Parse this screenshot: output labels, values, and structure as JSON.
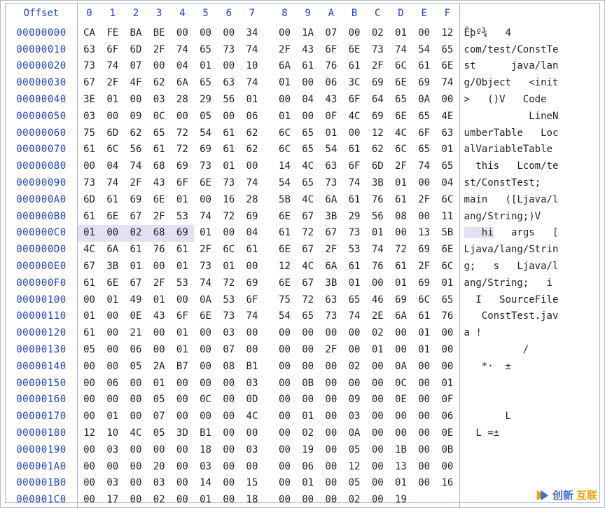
{
  "header": {
    "offset": "Offset",
    "cols": [
      "0",
      "1",
      "2",
      "3",
      "4",
      "5",
      "6",
      "7",
      "8",
      "9",
      "A",
      "B",
      "C",
      "D",
      "E",
      "F"
    ]
  },
  "logo": {
    "part1": "创新",
    "part2": "互联"
  },
  "selection": {
    "row": 12,
    "cols": [
      0,
      1,
      2,
      3,
      4
    ]
  },
  "rows": [
    {
      "offset": "00000000",
      "hex": [
        "CA",
        "FE",
        "BA",
        "BE",
        "00",
        "00",
        "00",
        "34",
        "00",
        "1A",
        "07",
        "00",
        "02",
        "01",
        "00",
        "12"
      ],
      "ascii": "Êþº¾   4        "
    },
    {
      "offset": "00000010",
      "hex": [
        "63",
        "6F",
        "6D",
        "2F",
        "74",
        "65",
        "73",
        "74",
        "2F",
        "43",
        "6F",
        "6E",
        "73",
        "74",
        "54",
        "65"
      ],
      "ascii": "com/test/ConstTe"
    },
    {
      "offset": "00000020",
      "hex": [
        "73",
        "74",
        "07",
        "00",
        "04",
        "01",
        "00",
        "10",
        "6A",
        "61",
        "76",
        "61",
        "2F",
        "6C",
        "61",
        "6E"
      ],
      "ascii": "st      java/lan"
    },
    {
      "offset": "00000030",
      "hex": [
        "67",
        "2F",
        "4F",
        "62",
        "6A",
        "65",
        "63",
        "74",
        "01",
        "00",
        "06",
        "3C",
        "69",
        "6E",
        "69",
        "74"
      ],
      "ascii": "g/Object   <init"
    },
    {
      "offset": "00000040",
      "hex": [
        "3E",
        "01",
        "00",
        "03",
        "28",
        "29",
        "56",
        "01",
        "00",
        "04",
        "43",
        "6F",
        "64",
        "65",
        "0A",
        "00"
      ],
      "ascii": ">   ()V   Code  "
    },
    {
      "offset": "00000050",
      "hex": [
        "03",
        "00",
        "09",
        "0C",
        "00",
        "05",
        "00",
        "06",
        "01",
        "00",
        "0F",
        "4C",
        "69",
        "6E",
        "65",
        "4E"
      ],
      "ascii": "           LineN"
    },
    {
      "offset": "00000060",
      "hex": [
        "75",
        "6D",
        "62",
        "65",
        "72",
        "54",
        "61",
        "62",
        "6C",
        "65",
        "01",
        "00",
        "12",
        "4C",
        "6F",
        "63"
      ],
      "ascii": "umberTable   Loc"
    },
    {
      "offset": "00000070",
      "hex": [
        "61",
        "6C",
        "56",
        "61",
        "72",
        "69",
        "61",
        "62",
        "6C",
        "65",
        "54",
        "61",
        "62",
        "6C",
        "65",
        "01"
      ],
      "ascii": "alVariableTable "
    },
    {
      "offset": "00000080",
      "hex": [
        "00",
        "04",
        "74",
        "68",
        "69",
        "73",
        "01",
        "00",
        "14",
        "4C",
        "63",
        "6F",
        "6D",
        "2F",
        "74",
        "65"
      ],
      "ascii": "  this   Lcom/te"
    },
    {
      "offset": "00000090",
      "hex": [
        "73",
        "74",
        "2F",
        "43",
        "6F",
        "6E",
        "73",
        "74",
        "54",
        "65",
        "73",
        "74",
        "3B",
        "01",
        "00",
        "04"
      ],
      "ascii": "st/ConstTest;   "
    },
    {
      "offset": "000000A0",
      "hex": [
        "6D",
        "61",
        "69",
        "6E",
        "01",
        "00",
        "16",
        "28",
        "5B",
        "4C",
        "6A",
        "61",
        "76",
        "61",
        "2F",
        "6C"
      ],
      "ascii": "main   ([Ljava/l"
    },
    {
      "offset": "000000B0",
      "hex": [
        "61",
        "6E",
        "67",
        "2F",
        "53",
        "74",
        "72",
        "69",
        "6E",
        "67",
        "3B",
        "29",
        "56",
        "08",
        "00",
        "11"
      ],
      "ascii": "ang/String;)V   "
    },
    {
      "offset": "000000C0",
      "hex": [
        "01",
        "00",
        "02",
        "68",
        "69",
        "01",
        "00",
        "04",
        "61",
        "72",
        "67",
        "73",
        "01",
        "00",
        "13",
        "5B"
      ],
      "ascii": "   hi   args   ["
    },
    {
      "offset": "000000D0",
      "hex": [
        "4C",
        "6A",
        "61",
        "76",
        "61",
        "2F",
        "6C",
        "61",
        "6E",
        "67",
        "2F",
        "53",
        "74",
        "72",
        "69",
        "6E"
      ],
      "ascii": "Ljava/lang/Strin"
    },
    {
      "offset": "000000E0",
      "hex": [
        "67",
        "3B",
        "01",
        "00",
        "01",
        "73",
        "01",
        "00",
        "12",
        "4C",
        "6A",
        "61",
        "76",
        "61",
        "2F",
        "6C"
      ],
      "ascii": "g;   s   Ljava/l"
    },
    {
      "offset": "000000F0",
      "hex": [
        "61",
        "6E",
        "67",
        "2F",
        "53",
        "74",
        "72",
        "69",
        "6E",
        "67",
        "3B",
        "01",
        "00",
        "01",
        "69",
        "01"
      ],
      "ascii": "ang/String;   i "
    },
    {
      "offset": "00000100",
      "hex": [
        "00",
        "01",
        "49",
        "01",
        "00",
        "0A",
        "53",
        "6F",
        "75",
        "72",
        "63",
        "65",
        "46",
        "69",
        "6C",
        "65"
      ],
      "ascii": "  I   SourceFile"
    },
    {
      "offset": "00000110",
      "hex": [
        "01",
        "00",
        "0E",
        "43",
        "6F",
        "6E",
        "73",
        "74",
        "54",
        "65",
        "73",
        "74",
        "2E",
        "6A",
        "61",
        "76"
      ],
      "ascii": "   ConstTest.jav"
    },
    {
      "offset": "00000120",
      "hex": [
        "61",
        "00",
        "21",
        "00",
        "01",
        "00",
        "03",
        "00",
        "00",
        "00",
        "00",
        "00",
        "02",
        "00",
        "01",
        "00"
      ],
      "ascii": "a !             "
    },
    {
      "offset": "00000130",
      "hex": [
        "05",
        "00",
        "06",
        "00",
        "01",
        "00",
        "07",
        "00",
        "00",
        "00",
        "2F",
        "00",
        "01",
        "00",
        "01",
        "00"
      ],
      "ascii": "          /     "
    },
    {
      "offset": "00000140",
      "hex": [
        "00",
        "00",
        "05",
        "2A",
        "B7",
        "00",
        "08",
        "B1",
        "00",
        "00",
        "00",
        "02",
        "00",
        "0A",
        "00",
        "00"
      ],
      "ascii": "   *·  ±        "
    },
    {
      "offset": "00000150",
      "hex": [
        "00",
        "06",
        "00",
        "01",
        "00",
        "00",
        "00",
        "03",
        "00",
        "0B",
        "00",
        "00",
        "00",
        "0C",
        "00",
        "01"
      ],
      "ascii": "                "
    },
    {
      "offset": "00000160",
      "hex": [
        "00",
        "00",
        "00",
        "05",
        "00",
        "0C",
        "00",
        "0D",
        "00",
        "00",
        "00",
        "09",
        "00",
        "0E",
        "00",
        "0F"
      ],
      "ascii": "                "
    },
    {
      "offset": "00000170",
      "hex": [
        "00",
        "01",
        "00",
        "07",
        "00",
        "00",
        "00",
        "4C",
        "00",
        "01",
        "00",
        "03",
        "00",
        "00",
        "00",
        "06"
      ],
      "ascii": "       L        "
    },
    {
      "offset": "00000180",
      "hex": [
        "12",
        "10",
        "4C",
        "05",
        "3D",
        "B1",
        "00",
        "00",
        "00",
        "02",
        "00",
        "0A",
        "00",
        "00",
        "00",
        "0E"
      ],
      "ascii": "  L =±          "
    },
    {
      "offset": "00000190",
      "hex": [
        "00",
        "03",
        "00",
        "00",
        "00",
        "18",
        "00",
        "03",
        "00",
        "19",
        "00",
        "05",
        "00",
        "1B",
        "00",
        "0B"
      ],
      "ascii": "                "
    },
    {
      "offset": "000001A0",
      "hex": [
        "00",
        "00",
        "00",
        "20",
        "00",
        "03",
        "00",
        "00",
        "00",
        "06",
        "00",
        "12",
        "00",
        "13",
        "00",
        "00"
      ],
      "ascii": "                "
    },
    {
      "offset": "000001B0",
      "hex": [
        "00",
        "03",
        "00",
        "03",
        "00",
        "14",
        "00",
        "15",
        "00",
        "01",
        "00",
        "05",
        "00",
        "01",
        "00",
        "16"
      ],
      "ascii": "                "
    },
    {
      "offset": "000001C0",
      "hex": [
        "00",
        "17",
        "00",
        "02",
        "00",
        "01",
        "00",
        "18",
        "00",
        "00",
        "00",
        "02",
        "00",
        "19"
      ],
      "ascii": "              "
    }
  ]
}
